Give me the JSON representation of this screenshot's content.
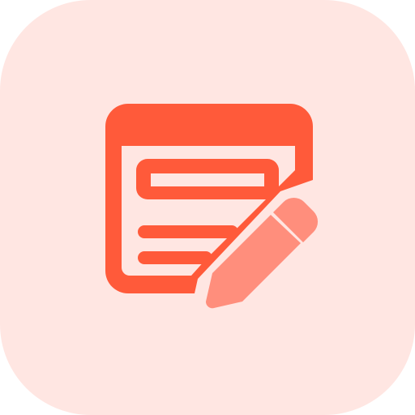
{
  "icon": {
    "name": "edit-form-icon",
    "colors": {
      "background": "#ffe6e2",
      "primary": "#ff5a3a",
      "secondary": "#ff8e7c"
    }
  }
}
